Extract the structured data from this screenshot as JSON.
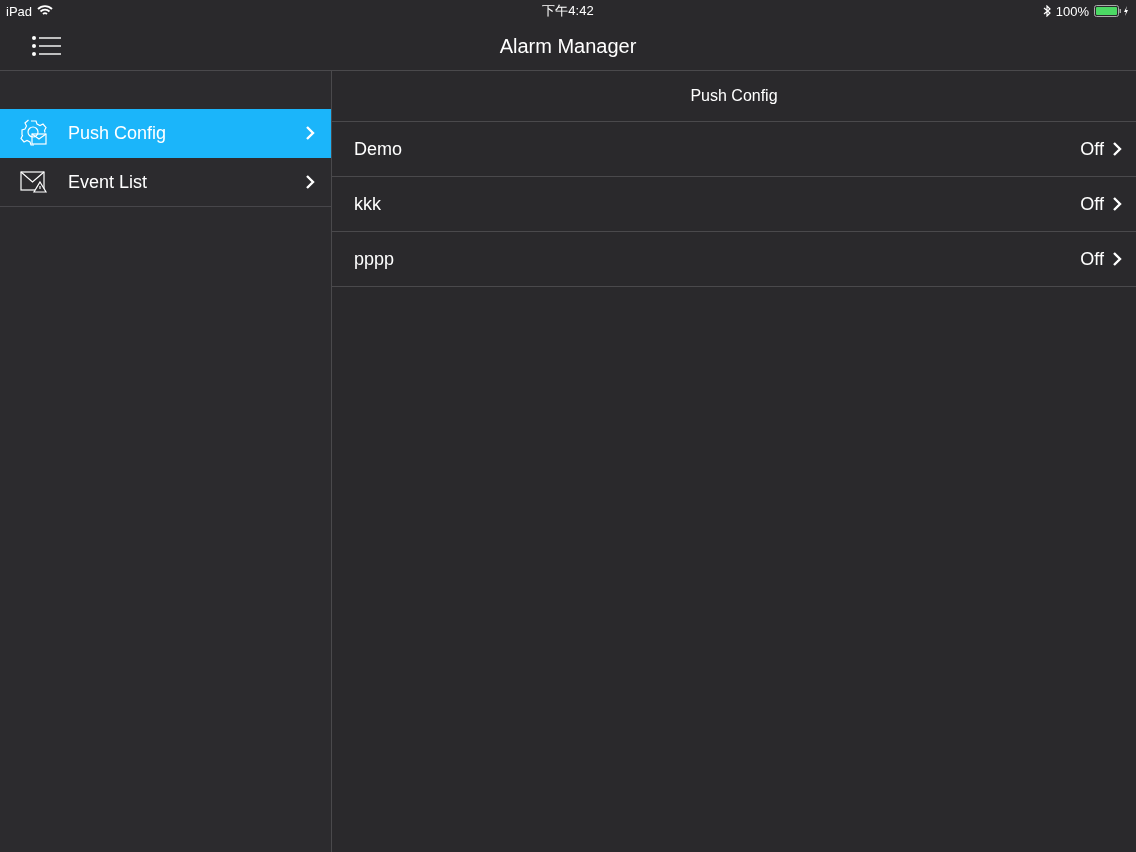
{
  "status_bar": {
    "device": "iPad",
    "time": "下午4:42",
    "battery": "100%"
  },
  "nav_bar": {
    "title": "Alarm Manager"
  },
  "sidebar": {
    "items": [
      {
        "label": "Push Config",
        "kind": "config",
        "selected": true
      },
      {
        "label": "Event List",
        "kind": "events",
        "selected": false
      }
    ]
  },
  "detail": {
    "title": "Push Config",
    "rows": [
      {
        "name": "Demo",
        "value": "Off"
      },
      {
        "name": "kkk",
        "value": "Off"
      },
      {
        "name": "pppp",
        "value": "Off"
      }
    ]
  }
}
